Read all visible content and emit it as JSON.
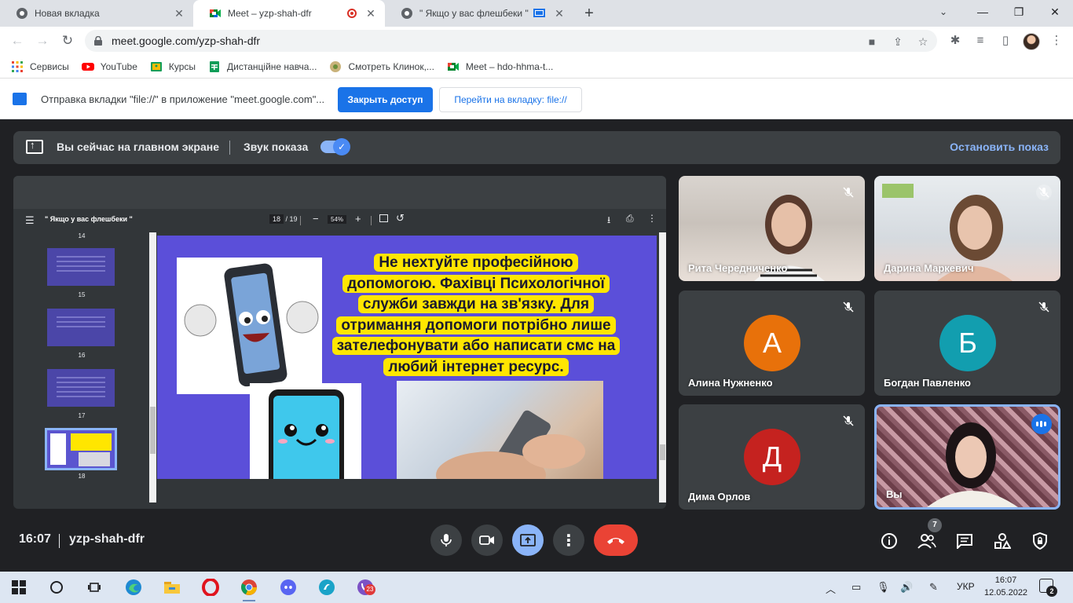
{
  "browser": {
    "tabs": [
      {
        "label": "Новая вкладка"
      },
      {
        "label": "Meet – yzp-shah-dfr"
      },
      {
        "label": "\" Якщо у вас флешбеки \""
      }
    ],
    "url": "meet.google.com/yzp-shah-dfr",
    "bookmarks": [
      {
        "label": "Сервисы"
      },
      {
        "label": "YouTube"
      },
      {
        "label": "Курсы"
      },
      {
        "label": "Дистанційне навча..."
      },
      {
        "label": "Смотреть Клинок,..."
      },
      {
        "label": "Meet – hdo-hhma-t..."
      }
    ]
  },
  "infobar": {
    "message": "Отправка вкладки \"file://\" в приложение \"meet.google.com\"...",
    "primary_label": "Закрыть доступ",
    "secondary_label": "Перейти на вкладку: file://"
  },
  "presenting": {
    "status": "Вы сейчас на главном экране",
    "sound_label": "Звук показа",
    "sound_enabled": true,
    "stop_label": "Остановить показ"
  },
  "pdf": {
    "title": "\" Якщо у вас флешбеки \"",
    "page": "18",
    "total": "/ 19",
    "zoom": "54%",
    "thumbnails": [
      "14",
      "15",
      "16",
      "17",
      "18"
    ],
    "current_thumbnail": "18"
  },
  "slide": {
    "lines": [
      "Не нехтуйте професійною",
      "допомогою. Фахівці Психологічної",
      "служби завжди на зв'язку. Для",
      "отримання допомоги потрібно лише",
      "зателефонувати або написати смс на",
      "любий інтернет ресурс."
    ],
    "highlight_color": "#ffe600",
    "background_color": "#5b4fd9"
  },
  "participants": [
    {
      "name": "Рита Чередниченко",
      "muted": true,
      "video": true
    },
    {
      "name": "Дарина Маркевич",
      "muted": true,
      "video": true
    },
    {
      "name": "Алина Нужненко",
      "muted": true,
      "initial": "А",
      "color": "#e8710a"
    },
    {
      "name": "Богдан Павленко",
      "muted": true,
      "initial": "Б",
      "color": "#129eaf"
    },
    {
      "name": "Дима Орлов",
      "muted": true,
      "initial": "Д",
      "color": "#c5221f"
    },
    {
      "name": "Вы",
      "speaking": true,
      "video": true
    }
  ],
  "meeting": {
    "time": "16:07",
    "code": "yzp-shah-dfr",
    "participant_count": "7"
  },
  "taskbar": {
    "language": "УКР",
    "time": "16:07",
    "date": "12.05.2022",
    "notifications": "2",
    "viber_badge": "23"
  }
}
